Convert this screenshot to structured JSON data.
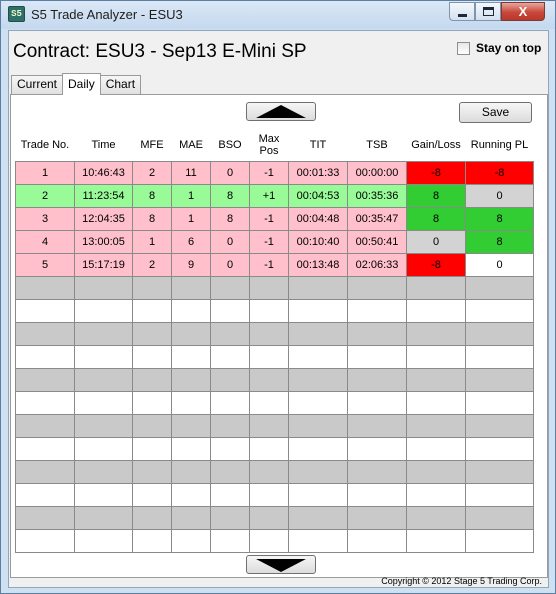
{
  "window": {
    "icon_text": "S5",
    "title": "S5 Trade Analyzer - ESU3",
    "close_glyph": "X"
  },
  "contract_title": "Contract: ESU3 - Sep13 E-Mini SP",
  "stay_on_top": {
    "label": "Stay on top",
    "checked": false
  },
  "tabs": [
    {
      "label": "Current",
      "active": false
    },
    {
      "label": "Daily",
      "active": true
    },
    {
      "label": "Chart",
      "active": false
    }
  ],
  "save_label": "Save",
  "columns": [
    "Trade No.",
    "Time",
    "MFE",
    "MAE",
    "BSO",
    "Max Pos",
    "TIT",
    "TSB",
    "Gain/Loss",
    "Running PL"
  ],
  "trades": [
    {
      "row": "loss",
      "cells": [
        "1",
        "10:46:43",
        "2",
        "11",
        "0",
        "-1",
        "00:01:33",
        "00:00:00",
        "-8",
        "-8"
      ],
      "gain_color": "red",
      "pl_color": "red"
    },
    {
      "row": "win",
      "cells": [
        "2",
        "11:23:54",
        "8",
        "1",
        "8",
        "+1",
        "00:04:53",
        "00:35:36",
        "8",
        "0"
      ],
      "gain_color": "green",
      "pl_color": "gray"
    },
    {
      "row": "loss",
      "cells": [
        "3",
        "12:04:35",
        "8",
        "1",
        "8",
        "-1",
        "00:04:48",
        "00:35:47",
        "8",
        "8"
      ],
      "gain_color": "green",
      "pl_color": "green"
    },
    {
      "row": "loss",
      "cells": [
        "4",
        "13:00:05",
        "1",
        "6",
        "0",
        "-1",
        "00:10:40",
        "00:50:41",
        "0",
        "8"
      ],
      "gain_color": "gray",
      "pl_color": "green"
    },
    {
      "row": "loss",
      "cells": [
        "5",
        "15:17:19",
        "2",
        "9",
        "0",
        "-1",
        "00:13:48",
        "02:06:33",
        "-8",
        "0"
      ],
      "gain_color": "red",
      "pl_color": "white"
    }
  ],
  "empty_rows": 12,
  "copyright": "Copyright © 2012 Stage 5 Trading Corp."
}
